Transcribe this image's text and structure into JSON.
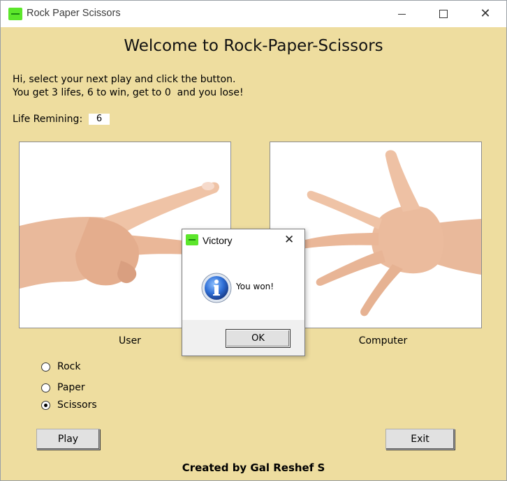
{
  "window": {
    "title": "Rock Paper Scissors"
  },
  "header": {
    "title": "Welcome to Rock-Paper-Scissors"
  },
  "instructions": {
    "line1": "Hi, select your next play and click the button.",
    "line2": "You get 3 lifes, 6 to win, get to 0  and you lose!"
  },
  "life": {
    "label": "Life Remining:",
    "value": "6"
  },
  "panels": {
    "user_caption": "User",
    "computer_caption": "Computer"
  },
  "choices": [
    {
      "label": "Rock",
      "selected": false
    },
    {
      "label": "Paper",
      "selected": false
    },
    {
      "label": "Scissors",
      "selected": true
    }
  ],
  "buttons": {
    "play": "Play",
    "exit": "Exit"
  },
  "footer": {
    "credit": "Created by Gal Reshef S"
  },
  "dialog": {
    "title": "Victory",
    "message": "You won!",
    "ok": "OK",
    "icon": "info-icon"
  },
  "colors": {
    "background": "#eedd9f",
    "app_icon": "#5ce62b"
  }
}
